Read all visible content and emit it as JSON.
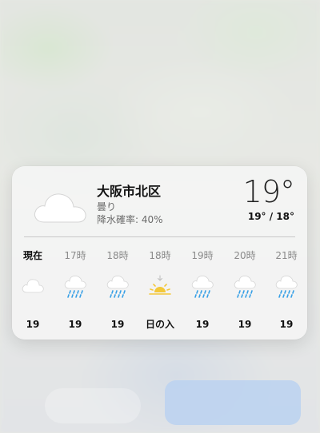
{
  "location": "大阪市北区",
  "condition": "曇り",
  "precipitation": "降水確率: 40%",
  "current_temp": "19°",
  "hi_lo": "19° / 18°",
  "hours": [
    {
      "label": "現在",
      "icon": "cloud-icon",
      "temp": "19",
      "now": true
    },
    {
      "label": "17時",
      "icon": "cloud-rain-icon",
      "temp": "19"
    },
    {
      "label": "18時",
      "icon": "cloud-rain-icon",
      "temp": "19"
    },
    {
      "label": "18時",
      "icon": "sunset-icon",
      "temp": "日の入"
    },
    {
      "label": "19時",
      "icon": "cloud-rain-icon",
      "temp": "19"
    },
    {
      "label": "20時",
      "icon": "cloud-rain-icon",
      "temp": "19"
    },
    {
      "label": "21時",
      "icon": "cloud-rain-icon",
      "temp": "19"
    }
  ],
  "colors": {
    "rain": "#37a0e6",
    "sun": "#f3c83b",
    "cloud_fill": "#ffffff",
    "cloud_stroke": "#d5d5d5"
  }
}
